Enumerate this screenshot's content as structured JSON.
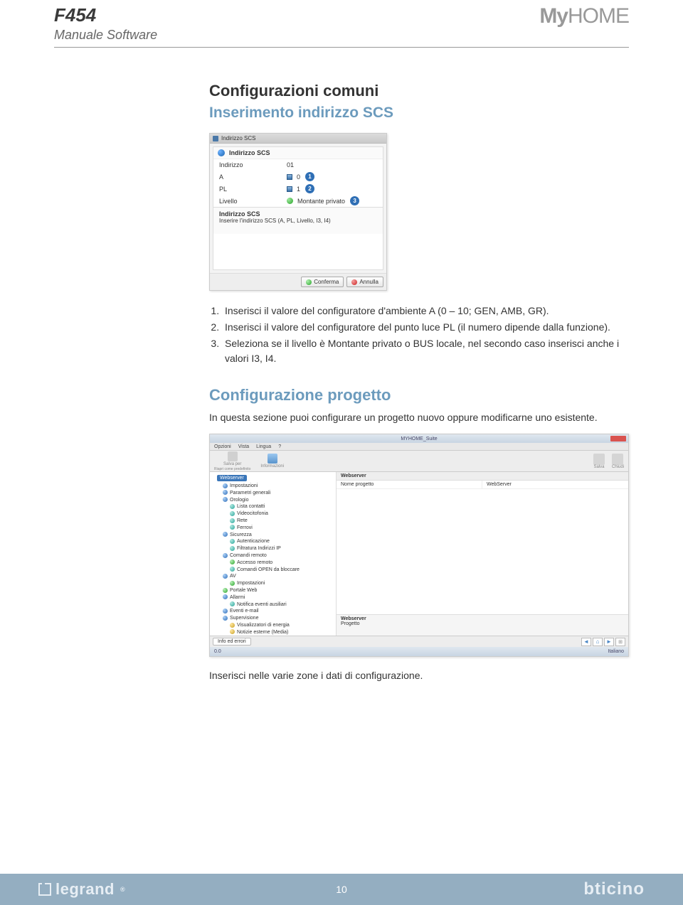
{
  "header": {
    "code": "F454",
    "subtitle": "Manuale Software",
    "brand_my": "My",
    "brand_home": "HOME"
  },
  "section1": {
    "title": "Configurazioni comuni",
    "subtitle": "Inserimento indirizzo SCS"
  },
  "dialog1": {
    "title": "Indirizzo SCS",
    "group": "Indirizzo SCS",
    "rows": [
      {
        "k": "Indirizzo",
        "v": "01",
        "callout": ""
      },
      {
        "k": "A",
        "v": "0",
        "icon": "sq",
        "callout": "1"
      },
      {
        "k": "PL",
        "v": "1",
        "icon": "sq",
        "callout": "2"
      },
      {
        "k": "Livello",
        "v": "Montante privato",
        "icon": "ball",
        "callout": "3"
      }
    ],
    "desc_title": "Indirizzo SCS",
    "desc_text": "Inserire l'indirizzo SCS (A, PL, Livello, I3, I4)",
    "confirm": "Conferma",
    "cancel": "Annulla"
  },
  "steps": [
    "Inserisci il valore del configuratore d'ambiente A (0 – 10; GEN, AMB, GR).",
    "Inserisci il valore del configuratore del punto luce PL (il numero dipende dalla funzione).",
    "Seleziona se il livello è Montante privato o BUS locale, nel secondo caso inserisci anche i valori I3, I4."
  ],
  "section2": {
    "title": "Configurazione progetto",
    "para": "In questa sezione puoi configurare un progetto nuovo oppure modificarne uno esistente."
  },
  "dialog2": {
    "apptitle": "MYHOME_Suite",
    "menu": [
      "Opzioni",
      "Vista",
      "Lingua",
      "?"
    ],
    "ribbon_left": [
      {
        "label": "Salva per",
        "sub": "Riapri come predefinito"
      },
      {
        "label": "Informazioni"
      }
    ],
    "ribbon_right": [
      {
        "label": "Salva"
      },
      {
        "label": "Chiudi"
      }
    ],
    "tree_root": "Webserver",
    "tree": [
      {
        "b": "b-blue",
        "t": "Impostazioni"
      },
      {
        "b": "b-blue",
        "t": "Parametri generali"
      },
      {
        "b": "b-blue",
        "t": "Orologio"
      },
      {
        "b": "b-teal",
        "t": "Lista contatti",
        "indent": 1
      },
      {
        "b": "b-teal",
        "t": "Videocitofonia",
        "indent": 1
      },
      {
        "b": "b-teal",
        "t": "Rete",
        "indent": 1
      },
      {
        "b": "b-teal",
        "t": "Ferrovi",
        "indent": 1
      },
      {
        "b": "b-blue",
        "t": "Sicurezza"
      },
      {
        "b": "b-teal",
        "t": "Autenticazione",
        "indent": 1
      },
      {
        "b": "b-teal",
        "t": "Filtratura Indirizzi IP",
        "indent": 1
      },
      {
        "b": "b-blue",
        "t": "Comandi remoto"
      },
      {
        "b": "b-green",
        "t": "Accesso remoto",
        "indent": 1
      },
      {
        "b": "b-teal",
        "t": "Comandi OPEN da bloccare",
        "indent": 1
      },
      {
        "b": "b-blue",
        "t": "AV"
      },
      {
        "b": "b-green",
        "t": "Impostazioni",
        "indent": 1
      },
      {
        "b": "b-green",
        "t": "Portale Web"
      },
      {
        "b": "b-blue",
        "t": "Allarmi"
      },
      {
        "b": "b-teal",
        "t": "Notifica eventi ausiliari",
        "indent": 1
      },
      {
        "b": "b-blue",
        "t": "Eventi e-mail"
      },
      {
        "b": "b-blue",
        "t": "Supervisione"
      },
      {
        "b": "b-gold",
        "t": "Visualizzatori di energia",
        "indent": 1
      },
      {
        "b": "b-gold",
        "t": "Notizie esterne (Media)",
        "indent": 1
      }
    ],
    "props_header": "Webserver",
    "props_rows": [
      {
        "k": "Nome progetto",
        "v": "WebServer"
      }
    ],
    "desc2_title": "Webserver",
    "desc2_text": "Progetto",
    "info_btn": "Info ed errori",
    "status_left": "0.0",
    "status_right": "Italiano"
  },
  "caption": "Inserisci nelle varie zone i dati di configurazione.",
  "footer": {
    "legrand": "legrand",
    "page": "10",
    "bticino": "bticino"
  }
}
